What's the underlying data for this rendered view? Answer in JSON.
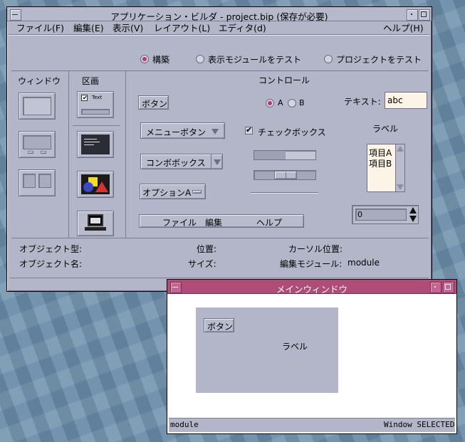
{
  "main_window": {
    "title": "アプリケーション・ビルダ - project.bip (保存が必要)",
    "menu": [
      "ファイル(F)",
      "編集(E)",
      "表示(V)",
      "レイアウト(L)",
      "エディタ(d)"
    ],
    "help_menu": "ヘルプ(H)",
    "modes": [
      "構築",
      "表示モジュールをテスト",
      "プロジェクトをテスト"
    ],
    "selected_mode": "構築",
    "palette": {
      "window_header": "ウィンドウ",
      "canvas_header": "区画",
      "control_header": "コントロール",
      "mini_button_text": "Text"
    },
    "controls": {
      "button_label": "ボタン",
      "radio_a": "A",
      "radio_b": "B",
      "text_field_label": "テキスト:",
      "text_field_value": "abc",
      "menu_button_label": "メニューボタン",
      "checkbox_label": "チェックボックス",
      "label_text": "ラベル",
      "combo_label": "コンボボックス",
      "list_items": [
        "項目A",
        "項目B"
      ],
      "option_label": "オプションA",
      "menubar_items": [
        "ファイル",
        "編集",
        "ヘルプ"
      ],
      "spin_value": "0"
    },
    "status": {
      "object_type_label": "オブジェクト型:",
      "object_name_label": "オブジェクト名:",
      "position_label": "位置:",
      "size_label": "サイズ:",
      "cursor_label": "カーソル位置:",
      "edit_module_label": "編集モジュール:",
      "edit_module_value": "module"
    }
  },
  "preview_window": {
    "title": "メインウィンドウ",
    "button_label": "ボタン",
    "label_text": "ラベル",
    "footer_left": "module",
    "footer_right": "Window SELECTED"
  }
}
